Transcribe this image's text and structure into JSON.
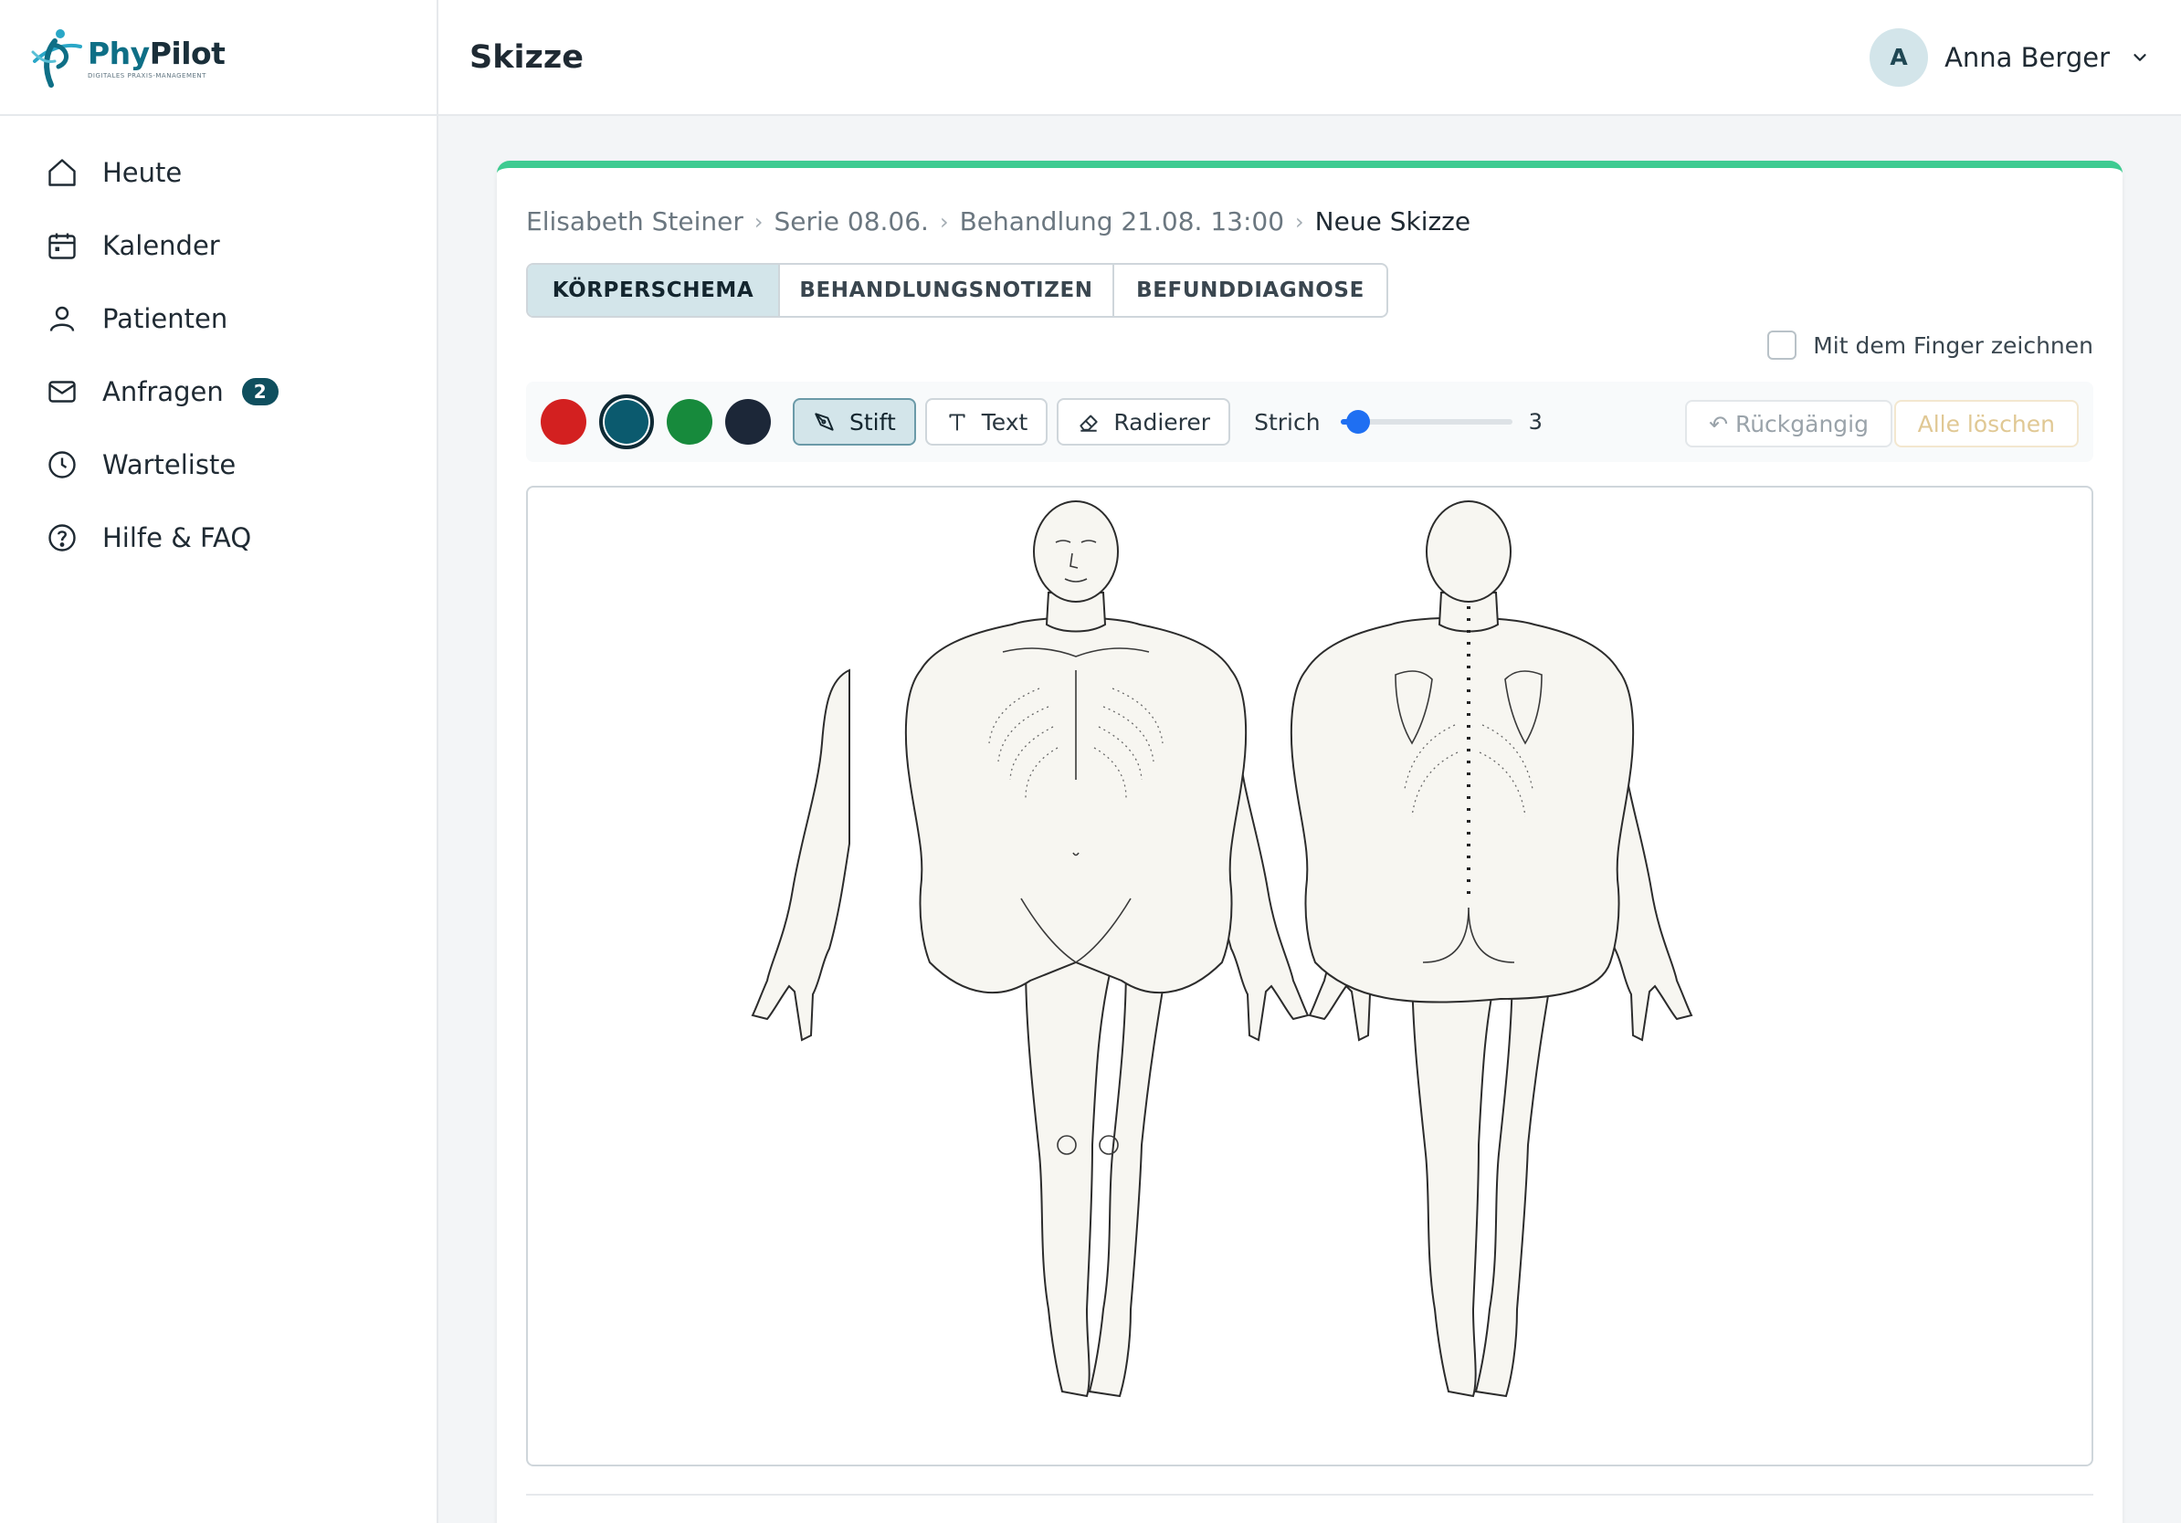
{
  "app": {
    "brand_first": "Phy",
    "brand_second": "Pilot",
    "tagline": "DIGITALES PRAXIS-MANAGEMENT"
  },
  "sidebar": {
    "items": [
      {
        "label": "Heute",
        "icon": "home-icon"
      },
      {
        "label": "Kalender",
        "icon": "calendar-icon"
      },
      {
        "label": "Patienten",
        "icon": "user-icon"
      },
      {
        "label": "Anfragen",
        "icon": "mail-icon",
        "badge": "2"
      },
      {
        "label": "Warteliste",
        "icon": "clock-icon"
      },
      {
        "label": "Hilfe & FAQ",
        "icon": "help-icon"
      }
    ]
  },
  "header": {
    "title": "Skizze",
    "user": {
      "initial": "A",
      "name": "Anna Berger"
    }
  },
  "breadcrumb": [
    "Elisabeth Steiner",
    "Serie 08.06.",
    "Behandlung 21.08. 13:00",
    "Neue Skizze"
  ],
  "tabs": [
    {
      "label": "KÖRPERSCHEMA",
      "active": true
    },
    {
      "label": "BEHANDLUNGSNOTIZEN",
      "active": false
    },
    {
      "label": "BEFUNDDIAGNOSE",
      "active": false
    }
  ],
  "finger_draw_label": "Mit dem Finger zeichnen",
  "toolbar": {
    "colors": [
      {
        "name": "red",
        "hex": "#d32020"
      },
      {
        "name": "teal",
        "hex": "#0b5a6e",
        "selected": true
      },
      {
        "name": "green",
        "hex": "#178a3c"
      },
      {
        "name": "navy",
        "hex": "#1c2738"
      }
    ],
    "pen_label": "Stift",
    "text_label": "Text",
    "eraser_label": "Radierer",
    "stroke_label": "Strich",
    "stroke_value": "3",
    "stroke_min": 1,
    "stroke_max": 20,
    "undo_label": "↶ Rückgängig",
    "clear_label": "Alle löschen"
  },
  "colors": {
    "accent": "#0f4f5e",
    "highlight": "#d3e5ea",
    "card_top": "#3ecb91"
  }
}
